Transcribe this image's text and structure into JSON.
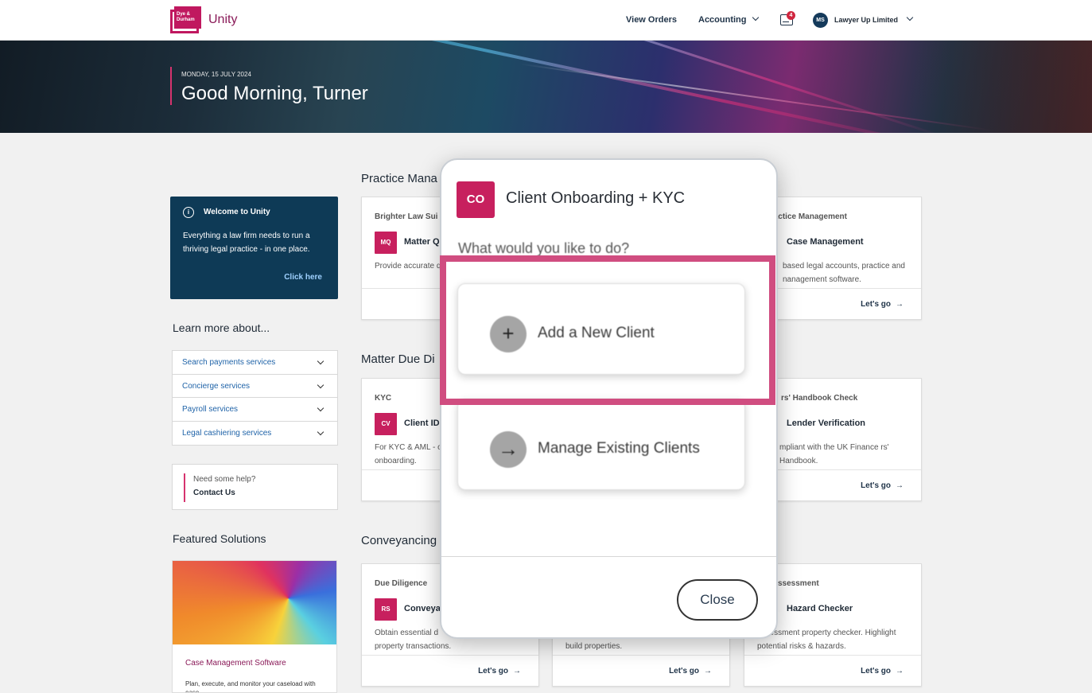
{
  "header": {
    "logo_text": "Dye & Durham",
    "brand": "Unity",
    "nav": {
      "view_orders": "View Orders",
      "accounting": "Accounting"
    },
    "notifications_count": "4",
    "user_initials": "MS",
    "account_name": "Lawyer Up Limited"
  },
  "hero": {
    "date": "MONDAY, 15 JULY 2024",
    "greeting": "Good Morning, Turner"
  },
  "welcome": {
    "title": "Welcome to Unity",
    "body": "Everything a law firm needs to run a thriving legal practice - in one place.",
    "link": "Click here"
  },
  "learn": {
    "title": "Learn more about...",
    "items": [
      "Search payments services",
      "Concierge services",
      "Payroll services",
      "Legal cashiering services"
    ]
  },
  "help": {
    "question": "Need some help?",
    "contact": "Contact Us"
  },
  "featured": {
    "title": "Featured Solutions",
    "name": "Case Management Software",
    "desc": "Plan, execute, and monitor your caseload with ease"
  },
  "sections": {
    "practice": "Practice Mana",
    "matter": "Matter Due Di",
    "conveyancing": "Conveyancing"
  },
  "cards": {
    "c1": {
      "sub": "Brighter Law Sui",
      "icon": "MQ",
      "title": "Matter Q",
      "desc": "Provide accurate quotations.",
      "go": ""
    },
    "c2": {
      "sub": "® Practice Management",
      "title": "Case Management",
      "desc": "based legal accounts, practice and nanagement software.",
      "go": "Let's go"
    },
    "c3": {
      "sub": "KYC",
      "icon": "CV",
      "title": "Client ID",
      "desc": "For KYC & AML - o onboarding.",
      "go": ""
    },
    "c4": {
      "sub": "rs' Handbook Check",
      "title": "Lender Verification",
      "desc": "mpliant with the UK Finance rs' Handbook.",
      "go": "Let's go"
    },
    "c5": {
      "sub": "Due Diligence",
      "icon": "RS",
      "title": "Conveya",
      "desc": "Obtain essential d property transactions.",
      "go": "Let's go"
    },
    "c6": {
      "desc": "build properties.",
      "go": "Let's go"
    },
    "c7": {
      "sub": "ssessment",
      "title": "Hazard Checker",
      "desc": "assessment property checker. Highlight potential risks & hazards.",
      "go": "Let's go"
    }
  },
  "modal": {
    "icon": "CO",
    "title": "Client Onboarding + KYC",
    "question": "What would you like to do?",
    "options": [
      {
        "icon": "+",
        "label": "Add a New Client"
      },
      {
        "icon": "→",
        "label": "Manage Existing Clients"
      }
    ],
    "close": "Close"
  },
  "colors": {
    "accent": "#c7205e",
    "navy": "#0e3a56",
    "highlight": "#d04d80"
  },
  "icons": [
    "info-icon",
    "inbox-icon",
    "chevron-down-icon",
    "arrow-right-icon",
    "plus-icon"
  ]
}
